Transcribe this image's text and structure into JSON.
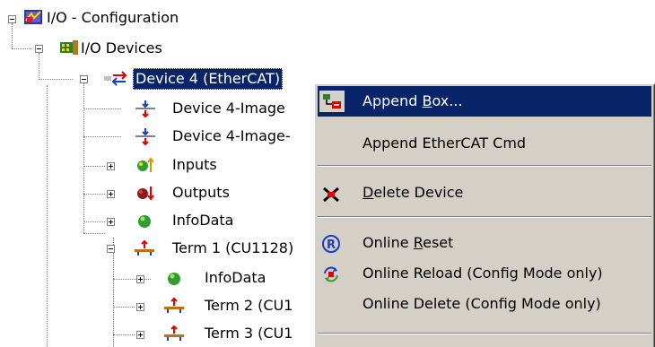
{
  "tree": {
    "root": {
      "label": "I/O - Configuration",
      "icon": "io-configuration-icon"
    },
    "io_devices": {
      "label": "I/O Devices",
      "icon": "io-devices-icon"
    },
    "device4": {
      "label": "Device 4 (EtherCAT)",
      "icon": "ethercat-device-icon"
    },
    "children": [
      {
        "label": "Device 4-Image",
        "icon": "process-image-icon"
      },
      {
        "label": "Device 4-Image-",
        "icon": "process-image-icon"
      },
      {
        "label": "Inputs",
        "icon": "inputs-icon"
      },
      {
        "label": "Outputs",
        "icon": "outputs-icon"
      },
      {
        "label": "InfoData",
        "icon": "infodata-icon"
      },
      {
        "label": "Term 1 (CU1128)",
        "icon": "terminal-icon"
      }
    ],
    "term1_children": [
      {
        "label": "InfoData",
        "icon": "infodata-icon"
      },
      {
        "label": "Term 2 (CU1",
        "icon": "terminal-icon"
      },
      {
        "label": "Term 3 (CU1",
        "icon": "terminal-icon"
      }
    ]
  },
  "context_menu": {
    "items": [
      {
        "pre": "Append ",
        "accel": "B",
        "post": "ox...",
        "icon": "append-box-icon",
        "highlighted": true
      },
      {
        "pre": "Append EtherCAT Cmd",
        "accel": "",
        "post": "",
        "icon": "",
        "highlighted": false
      },
      {
        "pre": "",
        "accel": "D",
        "post": "elete Device",
        "icon": "delete-device-icon",
        "highlighted": false
      },
      {
        "pre": "Online ",
        "accel": "R",
        "post": "eset",
        "icon": "online-reset-icon",
        "highlighted": false
      },
      {
        "pre": "Online Reload (Config Mode only)",
        "accel": "",
        "post": "",
        "icon": "online-reload-icon",
        "highlighted": false
      },
      {
        "pre": "Online Delete (Config Mode only)",
        "accel": "",
        "post": "",
        "icon": "",
        "highlighted": false
      }
    ]
  },
  "colors": {
    "selection": "#0a246a",
    "menu_bg": "#d4d0c8",
    "ethercat_red": "#e00000",
    "ethercat_blue": "#1a3cc8"
  }
}
